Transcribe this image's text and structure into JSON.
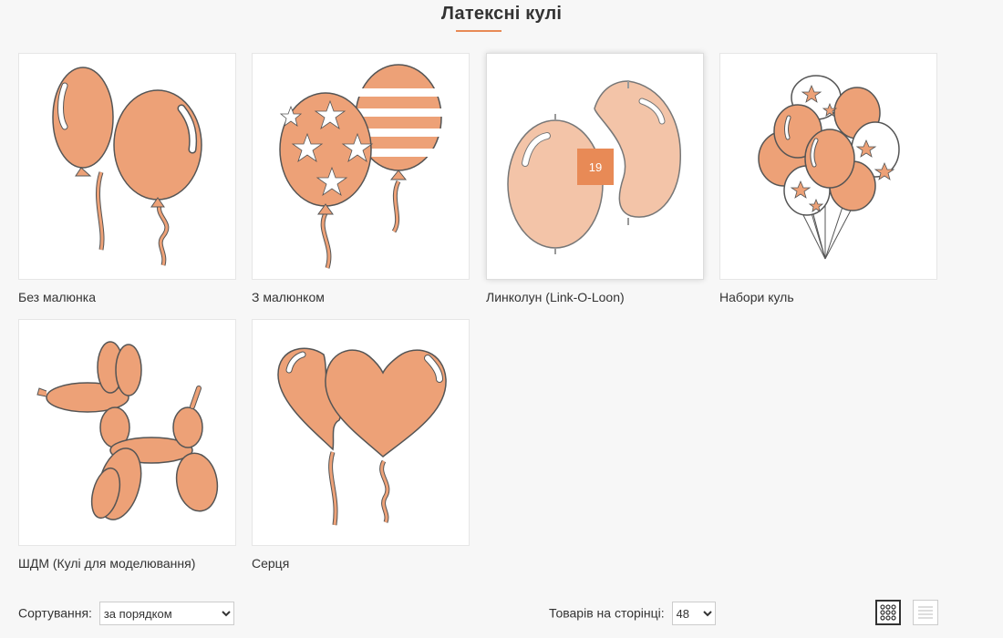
{
  "page": {
    "title": "Латексні кулі"
  },
  "categories": [
    {
      "label": "Без малюнка"
    },
    {
      "label": "З малюнком"
    },
    {
      "label": "Линколун (Link-O-Loon)",
      "badge": "19"
    },
    {
      "label": "Набори куль"
    },
    {
      "label": "ШДМ (Кулі для моделювання)"
    },
    {
      "label": "Серця"
    }
  ],
  "toolbar": {
    "sort_label": "Сортування:",
    "sort_value": "за порядком",
    "per_page_label": "Товарів на сторінці:",
    "per_page_value": "48"
  },
  "colors": {
    "accent": "#e88a56",
    "balloon": "#eda177",
    "balloon_light": "#f3c4a8"
  },
  "icons": [
    "grid-view-icon",
    "list-view-icon"
  ]
}
